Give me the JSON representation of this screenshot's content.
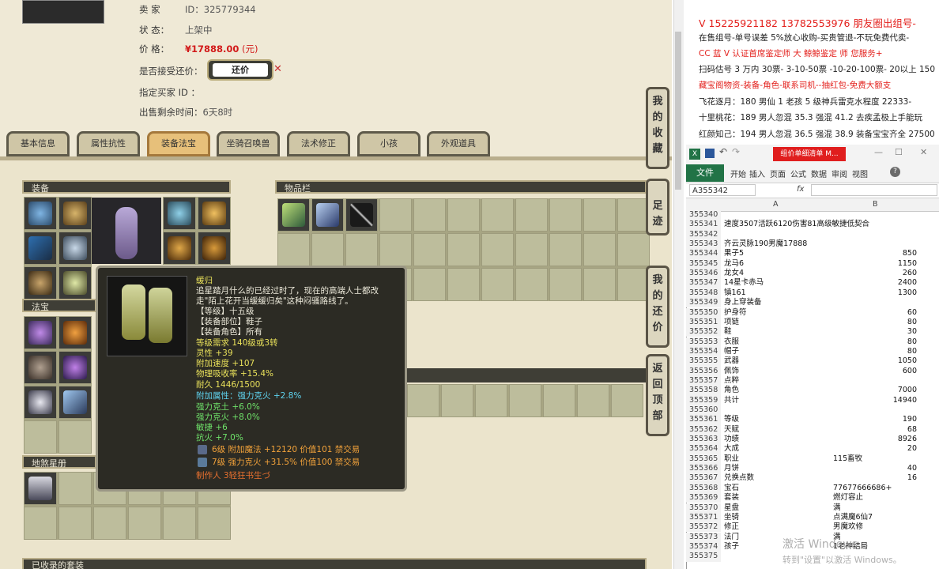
{
  "seller_info": {
    "seller_label": "卖 家",
    "seller_value": "ID：325779344",
    "status_label": "状 态：",
    "status_value": "上架中",
    "price_label": "价 格：",
    "price_value": "¥17888.00",
    "price_unit": "(元)",
    "counter_label": "是否接受还价：",
    "counter_button": "还价",
    "buyer_label": "指定买家 ID ：",
    "remaining_label": "出售剩余时间：",
    "remaining_value": "6天8时"
  },
  "tabs": [
    "基本信息",
    "属性抗性",
    "装备法宝",
    "坐骑召唤兽",
    "法术修正",
    "小孩",
    "外观道具"
  ],
  "active_tab": "装备法宝",
  "panels": {
    "equipment": "装备",
    "inventory": "物品栏",
    "fabao": "法宝",
    "dishaxing": "地煞星册",
    "collected": "已收录的套装"
  },
  "side_buttons": [
    "我的收藏",
    "足迹",
    "我的还价",
    "返回顶部"
  ],
  "tooltip": {
    "name": "缓归",
    "desc1": "追星踏月什么的已经过时了，现在的高端人士都改",
    "desc2": "走\"陌上花开当缓缓归矣\"这种闷骚路线了。",
    "level": "【等级】十五级",
    "slot": "【装备部位】鞋子",
    "role": "【装备角色】所有",
    "req": "等级需求 140级或3转",
    "stat1": "灵性 +39",
    "stat2": "附加速度 +107",
    "stat3": "物理吸收率 +15.4%",
    "durability": "耐久 1446/1500",
    "attr": "附加属性：强力克火 +2.8%",
    "g1": "强力克土 +6.0%",
    "g2": "强力克火 +8.0%",
    "g3": "敏捷 +6",
    "g4": "抗火 +7.0%",
    "gem1": "6级 附加魔法 +12120 价值101 禁交易",
    "gem2": "7级 强力克火 +31.5% 价值100 禁交易",
    "maker": "制作人 3轻狂书生づ"
  },
  "ads": [
    "V 15225921182 13782553976 朋友圈出组号-",
    "在售组号-单号误差 5%放心收购-买贵管退-不玩免费代卖-",
    "CC 蓝 V 认证首席鉴定师 大 鲸鲸鉴定 师 您服务+",
    "扫码估号 3 万内 30票- 3-10-50票 -10-20-100票- 20以上 150",
    "藏宝阁物资-装备-角色-联系司机--抽红包-免费大额支",
    "飞花逐月：180 男仙 1 老孩 5 级神兵雷克水程度 22333-",
    "十里桃花：189 男人忽混 35.3 强混 41.2 去疾孟极上手能玩",
    "红颜知己：194 男人忽混 36.5 强混 38.9 装备宝宝齐全 27500"
  ],
  "excel": {
    "title": "组价单细清单 M...",
    "file_tab": "文件",
    "ribbon_tabs": [
      "开始",
      "插入",
      "页面",
      "公式",
      "数据",
      "审阅",
      "视图"
    ],
    "name_box": "A355342",
    "fx": "fx",
    "col_a": "A",
    "col_b": "B",
    "rows": [
      {
        "n": "355340",
        "a": "",
        "b": ""
      },
      {
        "n": "355341",
        "a": "速度3507活跃6120伤害81高级敏捷低契合",
        "b": ""
      },
      {
        "n": "355342",
        "a": "",
        "b": ""
      },
      {
        "n": "355343",
        "a": "齐云灵脉190男魔17888",
        "b": ""
      },
      {
        "n": "355344",
        "a": "果子5",
        "b": "850"
      },
      {
        "n": "355345",
        "a": "龙马6",
        "b": "1150"
      },
      {
        "n": "355346",
        "a": "龙女4",
        "b": "260"
      },
      {
        "n": "355347",
        "a": "14星卡赤马",
        "b": "2400"
      },
      {
        "n": "355348",
        "a": "镇161",
        "b": "1300"
      },
      {
        "n": "355349",
        "a": "身上穿装备",
        "b": ""
      },
      {
        "n": "355350",
        "a": "护身符",
        "b": "60"
      },
      {
        "n": "355351",
        "a": "项链",
        "b": "80"
      },
      {
        "n": "355352",
        "a": "鞋",
        "b": "30"
      },
      {
        "n": "355353",
        "a": "衣服",
        "b": "80"
      },
      {
        "n": "355354",
        "a": "帽子",
        "b": "80"
      },
      {
        "n": "355355",
        "a": "武器",
        "b": "1050"
      },
      {
        "n": "355356",
        "a": "佩饰",
        "b": "600"
      },
      {
        "n": "355357",
        "a": "点粹",
        "b": ""
      },
      {
        "n": "355358",
        "a": "角色",
        "b": "7000"
      },
      {
        "n": "355359",
        "a": "共计",
        "b": "14940"
      },
      {
        "n": "355360",
        "a": "",
        "b": ""
      },
      {
        "n": "355361",
        "a": "等级",
        "b": "190"
      },
      {
        "n": "355362",
        "a": "天赋",
        "b": "68"
      },
      {
        "n": "355363",
        "a": "功绩",
        "b": "8926"
      },
      {
        "n": "355364",
        "a": "大成",
        "b": "20"
      },
      {
        "n": "355365",
        "a": "职业",
        "bl": "115畜牧"
      },
      {
        "n": "355366",
        "a": "月饼",
        "b": "40"
      },
      {
        "n": "355367",
        "a": "兑换点数",
        "b": "16"
      },
      {
        "n": "355368",
        "a": "宝石",
        "bl": "77677666686+"
      },
      {
        "n": "355369",
        "a": "套装",
        "bl": "燃灯容止"
      },
      {
        "n": "355370",
        "a": "星盘",
        "bl": "满"
      },
      {
        "n": "355371",
        "a": "坐骑",
        "bl": "点满魔6仙7"
      },
      {
        "n": "355372",
        "a": "修正",
        "bl": "男魔欢修"
      },
      {
        "n": "355373",
        "a": "法门",
        "bl": "满"
      },
      {
        "n": "355374",
        "a": "孩子",
        "bl": "1老神结局"
      },
      {
        "n": "355375",
        "a": "",
        "b": ""
      }
    ]
  },
  "watermark": "激活 Windows",
  "watermark_sub": "转到\"设置\"以激活 Windows。"
}
